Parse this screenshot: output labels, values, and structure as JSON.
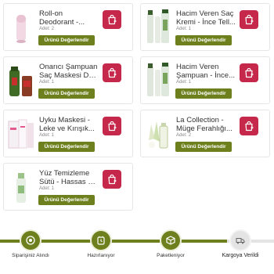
{
  "products": [
    {
      "name_line1": "Roll-on",
      "name_line2": "Deodorant -...",
      "qty": "Adet: 2",
      "button": "Ürünü Değerlendir",
      "thumb": "rollon"
    },
    {
      "name_line1": "Hacim Veren Saç",
      "name_line2": "Kremi - İnce Tell...",
      "qty": "Adet: 1",
      "button": "Ürünü Değerlendir",
      "thumb": "bottle-tall"
    },
    {
      "name_line1": "Onarıcı Şampuan",
      "name_line2": "Saç Maskesi Du...",
      "qty": "Adet: 1",
      "button": "Ürünü Değerlendir",
      "thumb": "shampoo-duo"
    },
    {
      "name_line1": "Hacim Veren",
      "name_line2": "Şampuan - İnce...",
      "qty": "Adet: 1",
      "button": "Ürünü Değerlendir",
      "thumb": "bottle-tall"
    },
    {
      "name_line1": "Uyku Maskesi -",
      "name_line2": "Leke ve Kırışık...",
      "qty": "Adet: 1",
      "button": "Ürünü Değerlendir",
      "thumb": "mask-box"
    },
    {
      "name_line1": "La Collection -",
      "name_line2": "Müge Ferahlığı...",
      "qty": "Adet: 2",
      "button": "Ürünü Değerlendir",
      "thumb": "perfume"
    },
    {
      "name_line1": "Yüz Temizleme",
      "name_line2": "Sütü - Hassas Ci...",
      "qty": "Adet: 1",
      "button": "Ürünü Değerlendir",
      "thumb": "cleanser"
    }
  ],
  "tracker": {
    "steps": [
      {
        "label": "Siparişiniz Alındı",
        "icon": "target-icon",
        "status": "done"
      },
      {
        "label": "Hazırlanıyor",
        "icon": "clock-icon",
        "status": "done"
      },
      {
        "label": "Paketleniyor",
        "icon": "box-icon",
        "status": "done"
      },
      {
        "label": "Kargoya Verildi",
        "icon": "truck-icon",
        "status": "pending"
      }
    ]
  },
  "colors": {
    "accent": "#6e7f1e",
    "cart": "#c5284b",
    "pending": "#e4e4e4"
  }
}
